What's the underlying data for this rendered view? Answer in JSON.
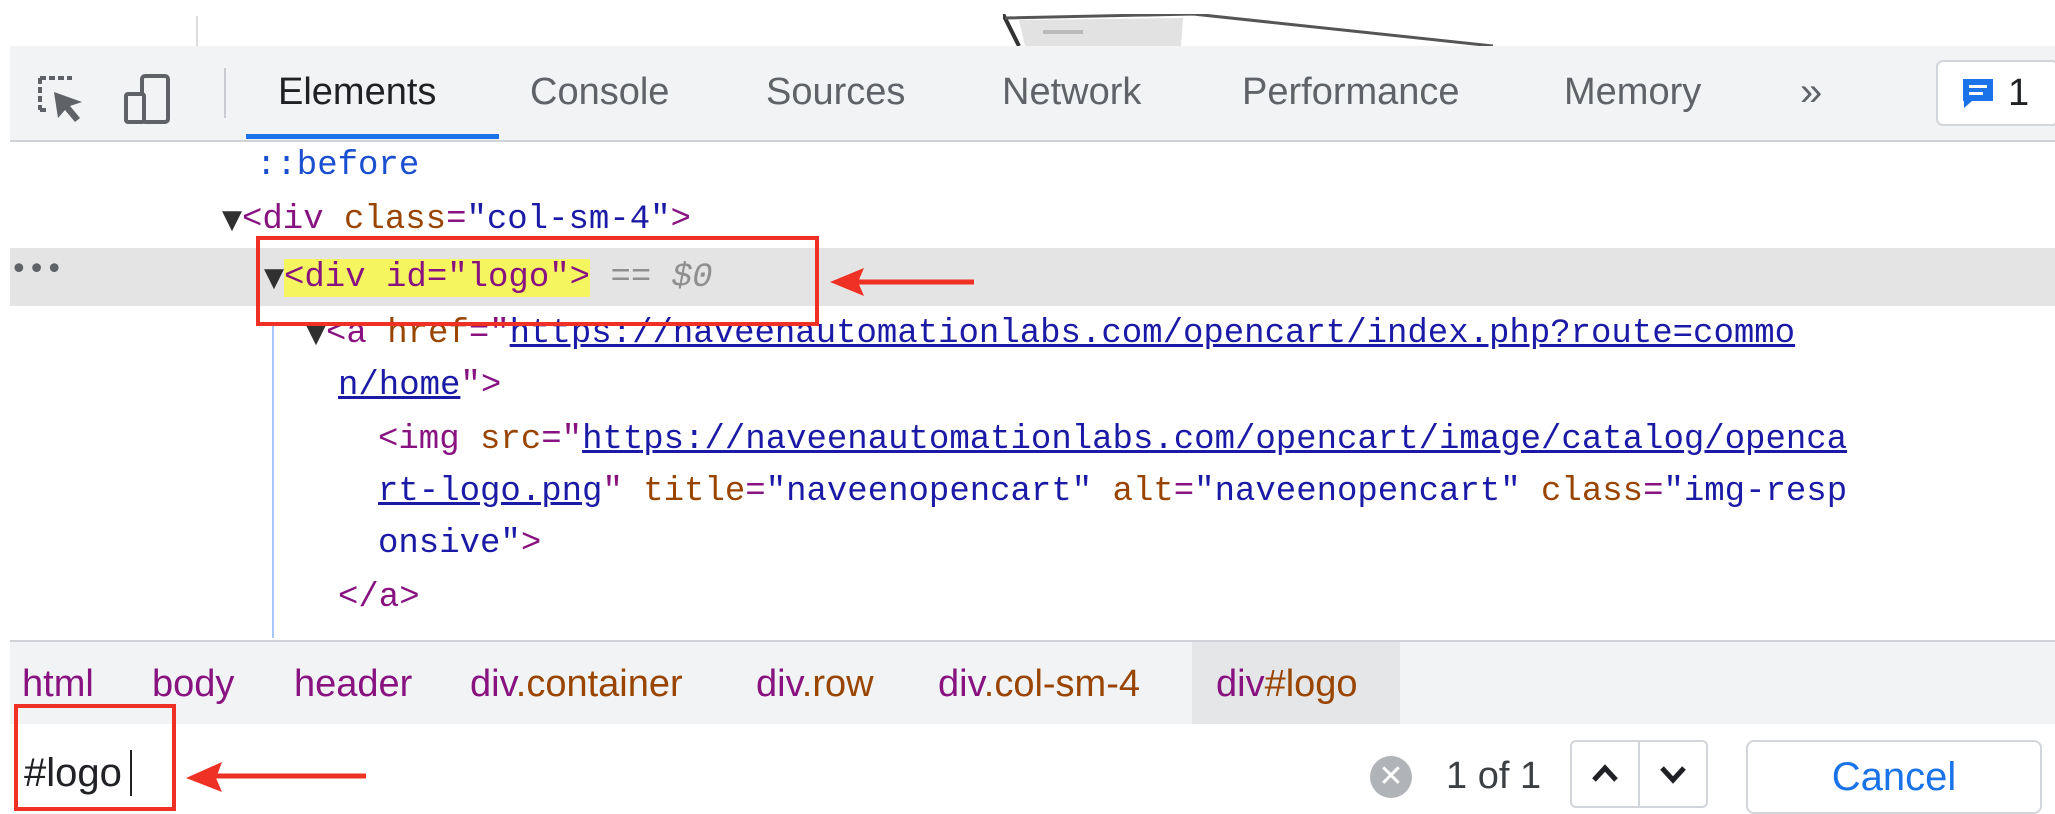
{
  "toolbar": {
    "tabs": [
      {
        "label": "Elements",
        "active": true
      },
      {
        "label": "Console",
        "active": false
      },
      {
        "label": "Sources",
        "active": false
      },
      {
        "label": "Network",
        "active": false
      },
      {
        "label": "Performance",
        "active": false
      },
      {
        "label": "Memory",
        "active": false
      }
    ],
    "overflow_label": "»",
    "issues_count": "1",
    "icons": [
      "inspect-element-icon",
      "device-toggle-icon",
      "issues-chat-icon"
    ],
    "accent_color": "#1a73e8"
  },
  "dom": {
    "pseudo_before": "::before",
    "col_div": {
      "open": "<div",
      "attr": "class",
      "eq": "=",
      "value": "\"col-sm-4\"",
      "close": ">"
    },
    "logo_div": {
      "text": "<div id=\"logo\">",
      "suffix": "== $0"
    },
    "anchor": {
      "open": "<a",
      "attr": "href",
      "eq": "=\"",
      "url_part1": "https://naveenautomationlabs.com/opencart/index.php?route=commo",
      "url_part2": "n/home",
      "close": "\">"
    },
    "img": {
      "open": "<img",
      "src_attr": "src",
      "eq": "=\"",
      "url_part1": "https://naveenautomationlabs.com/opencart/image/catalog/openca",
      "url_part2": "rt-logo.png",
      "quote": "\"",
      "title_attr": "title",
      "title_val": "\"naveenopencart\"",
      "alt_attr": "alt",
      "alt_val": "\"naveenopencart\"",
      "class_attr": "class",
      "class_val_part1": "\"img-resp",
      "class_val_part2": "onsive\"",
      "close": ">"
    },
    "anchor_close": "</a>",
    "ellipsis": "•••",
    "tag_color": "#881280",
    "attr_color": "#994500",
    "value_color": "#1a1aa6",
    "highlight_color": "#f5f560"
  },
  "breadcrumbs": {
    "items": [
      {
        "tag": "html",
        "cls": ""
      },
      {
        "tag": "body",
        "cls": ""
      },
      {
        "tag": "header",
        "cls": ""
      },
      {
        "tag": "div",
        "cls": ".container"
      },
      {
        "tag": "div",
        "cls": ".row"
      },
      {
        "tag": "div",
        "cls": ".col-sm-4"
      },
      {
        "tag": "div",
        "cls": "#logo"
      }
    ]
  },
  "search": {
    "value": "#logo",
    "match_count": "1 of 1",
    "cancel_label": "Cancel"
  },
  "annotation_color": "#ee3124"
}
